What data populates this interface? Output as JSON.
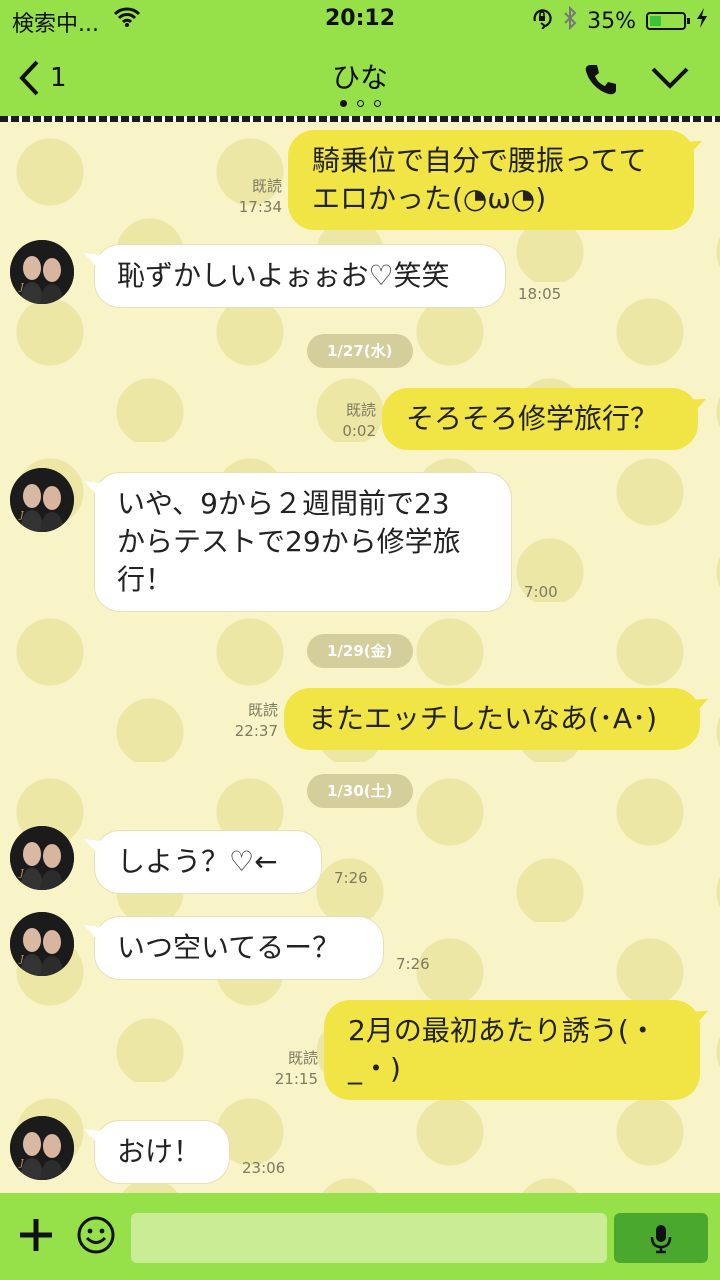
{
  "status_bar": {
    "carrier": "検索中...",
    "time": "20:12",
    "battery": "35%",
    "battery_level": 0.35
  },
  "header": {
    "back_count": "1",
    "title": "ひな",
    "page_indicator": {
      "count": 3,
      "active": 0
    },
    "icons": [
      "back-icon",
      "phone-icon",
      "chevron-down-icon"
    ]
  },
  "colors": {
    "bar_green": "#96e04a",
    "bubble_out": "#f0e545",
    "bubble_in": "#ffffff",
    "chat_bg": "#f8f4c8",
    "send_green": "#4aa82f"
  },
  "chat": {
    "read_label": "既読",
    "messages": [
      {
        "dir": "out",
        "text": "騎乗位で自分で腰振ってて\nエロかった(◔ω◔)",
        "time": "17:34",
        "read": true
      },
      {
        "dir": "in",
        "text": "恥ずかしいよぉぉお♡笑笑",
        "time": "18:05"
      },
      {
        "dir": "date",
        "text": "1/27(水)"
      },
      {
        "dir": "out",
        "text": "そろそろ修学旅行？",
        "time": "0:02",
        "read": true
      },
      {
        "dir": "in",
        "text": "いや、9から２週間前で23\nからテストで29から修学旅\n行！",
        "time": "7:00"
      },
      {
        "dir": "date",
        "text": "1/29(金)"
      },
      {
        "dir": "out",
        "text": "またエッチしたいなあ(･A･)",
        "time": "22:37",
        "read": true
      },
      {
        "dir": "date",
        "text": "1/30(土)"
      },
      {
        "dir": "in",
        "text": "しよう？♡←",
        "time": "7:26"
      },
      {
        "dir": "in",
        "text": "いつ空いてるー？",
        "time": "7:26"
      },
      {
        "dir": "out",
        "text": "2月の最初あたり誘う(・\n_・)",
        "time": "21:15",
        "read": true
      },
      {
        "dir": "in",
        "text": "おけ！",
        "time": "23:06"
      }
    ]
  },
  "input_bar": {
    "placeholder": "",
    "icons": [
      "plus-icon",
      "emoji-icon",
      "mic-icon"
    ]
  }
}
